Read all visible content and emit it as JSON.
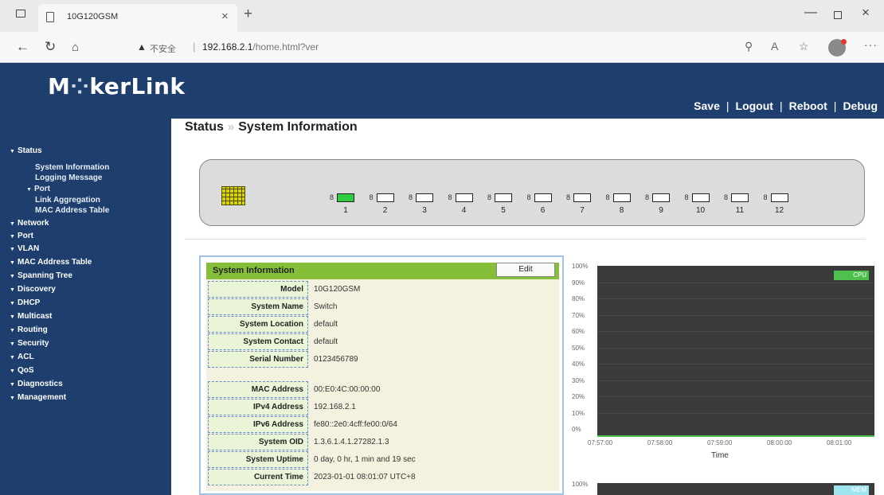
{
  "browser": {
    "tab_title": "10G120GSM",
    "insecure_label": "不安全",
    "url_host": "192.168.2.1",
    "url_path": "/home.html?ver",
    "tab_close": "×",
    "new_tab": "+"
  },
  "header": {
    "logo_prefix": "M",
    "logo_dots": "⁘",
    "logo_suffix": "kerLink",
    "links": [
      "Save",
      "Logout",
      "Reboot",
      "Debug"
    ],
    "separator": "|"
  },
  "sidebar": {
    "items": [
      {
        "label": "Status",
        "expanded": true
      },
      {
        "label": "System Information"
      },
      {
        "label": "Logging Message"
      },
      {
        "label": "Port"
      },
      {
        "label": "Link Aggregation"
      },
      {
        "label": "MAC Address Table"
      },
      {
        "label": "Network"
      },
      {
        "label": "Port"
      },
      {
        "label": "VLAN"
      },
      {
        "label": "MAC Address Table"
      },
      {
        "label": "Spanning Tree"
      },
      {
        "label": "Discovery"
      },
      {
        "label": "DHCP"
      },
      {
        "label": "Multicast"
      },
      {
        "label": "Routing"
      },
      {
        "label": "Security"
      },
      {
        "label": "ACL"
      },
      {
        "label": "QoS"
      },
      {
        "label": "Diagnostics"
      },
      {
        "label": "Management"
      }
    ]
  },
  "breadcrumb": {
    "parent": "Status",
    "separator": "»",
    "current": "System Information"
  },
  "ports": [
    {
      "num": "1",
      "status": "up"
    },
    {
      "num": "2",
      "status": "down"
    },
    {
      "num": "3",
      "status": "down"
    },
    {
      "num": "4",
      "status": "down"
    },
    {
      "num": "5",
      "status": "down"
    },
    {
      "num": "6",
      "status": "down"
    },
    {
      "num": "7",
      "status": "down"
    },
    {
      "num": "8",
      "status": "down"
    },
    {
      "num": "9",
      "status": "down"
    },
    {
      "num": "10",
      "status": "down"
    },
    {
      "num": "11",
      "status": "down"
    },
    {
      "num": "12",
      "status": "down"
    }
  ],
  "port_lead": "8",
  "system_info": {
    "title": "System Information",
    "edit_label": "Edit",
    "rows": [
      {
        "label": "Model",
        "value": "10G120GSM"
      },
      {
        "label": "System Name",
        "value": "Switch"
      },
      {
        "label": "System Location",
        "value": "default"
      },
      {
        "label": "System Contact",
        "value": "default"
      },
      {
        "label": "Serial Number",
        "value": "0123456789"
      },
      {
        "label": "MAC Address",
        "value": "00:E0:4C:00:00:00"
      },
      {
        "label": "IPv4 Address",
        "value": "192.168.2.1"
      },
      {
        "label": "IPv6 Address",
        "value": "fe80::2e0:4cff:fe00:0/64"
      },
      {
        "label": "System OID",
        "value": "1.3.6.1.4.1.27282.1.3"
      },
      {
        "label": "System Uptime",
        "value": "0 day, 0 hr, 1 min and 19 sec"
      },
      {
        "label": "Current Time",
        "value": "2023-01-01 08:01:07 UTC+8"
      }
    ]
  },
  "charts": {
    "cpu": {
      "legend": "CPU",
      "y_ticks": [
        "100%",
        "90%",
        "80%",
        "70%",
        "60%",
        "50%",
        "40%",
        "30%",
        "20%",
        "10%",
        "0%"
      ],
      "x_ticks": [
        "07:57:00",
        "07:58:00",
        "07:59:00",
        "08:00:00",
        "08:01:00"
      ],
      "x_title": "Time"
    },
    "mem": {
      "legend": "MEM",
      "y_ticks": [
        "100%"
      ]
    }
  },
  "colors": {
    "sidebar_bg": "#1e3f6e",
    "header_bar": "#85bf3a",
    "port_up": "#2ecc40",
    "chart_bg": "#3a3a3a"
  }
}
